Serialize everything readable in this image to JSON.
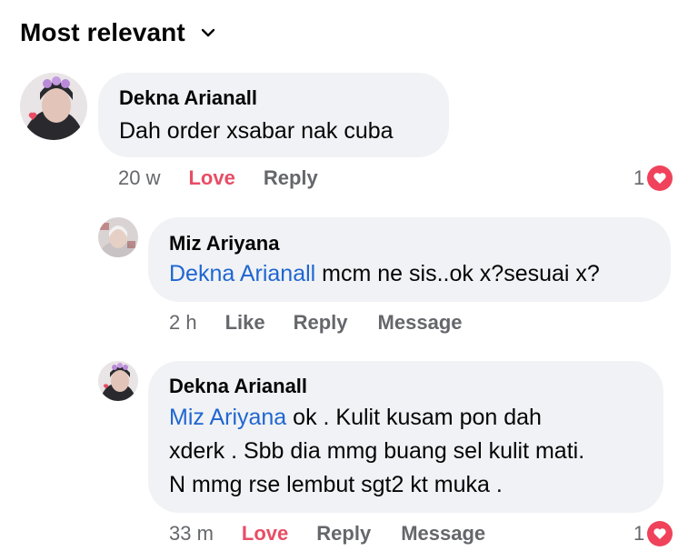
{
  "sort": {
    "label": "Most relevant"
  },
  "comments": [
    {
      "author": "Dekna Arianall",
      "mention": "",
      "lines": [
        "Dah order xsabar nak cuba"
      ],
      "time": "20 w",
      "like_label": "Love",
      "reply_label": "Reply",
      "message_label": "",
      "reaction_count": "1"
    },
    {
      "author": "Miz Ariyana",
      "mention": "Dekna Arianall",
      "lines": [
        " mcm ne sis..ok x?sesuai x?"
      ],
      "time": "2 h",
      "like_label": "Like",
      "reply_label": "Reply",
      "message_label": "Message",
      "reaction_count": ""
    },
    {
      "author": "Dekna Arianall",
      "mention": "Miz Ariyana",
      "lines": [
        " ok . Kulit kusam pon dah",
        "xderk . Sbb dia mmg buang sel kulit mati.",
        "N mmg rse lembut sgt2 kt muka ."
      ],
      "time": "33 m",
      "like_label": "Love",
      "reply_label": "Reply",
      "message_label": "Message",
      "reaction_count": "1"
    }
  ],
  "colors": {
    "love": "#e84d65",
    "mention": "#1f66d1",
    "bubble": "#f0f2f5",
    "meta": "#65676b"
  },
  "icons": [
    "chevron-down-icon",
    "heart-reaction-icon"
  ]
}
